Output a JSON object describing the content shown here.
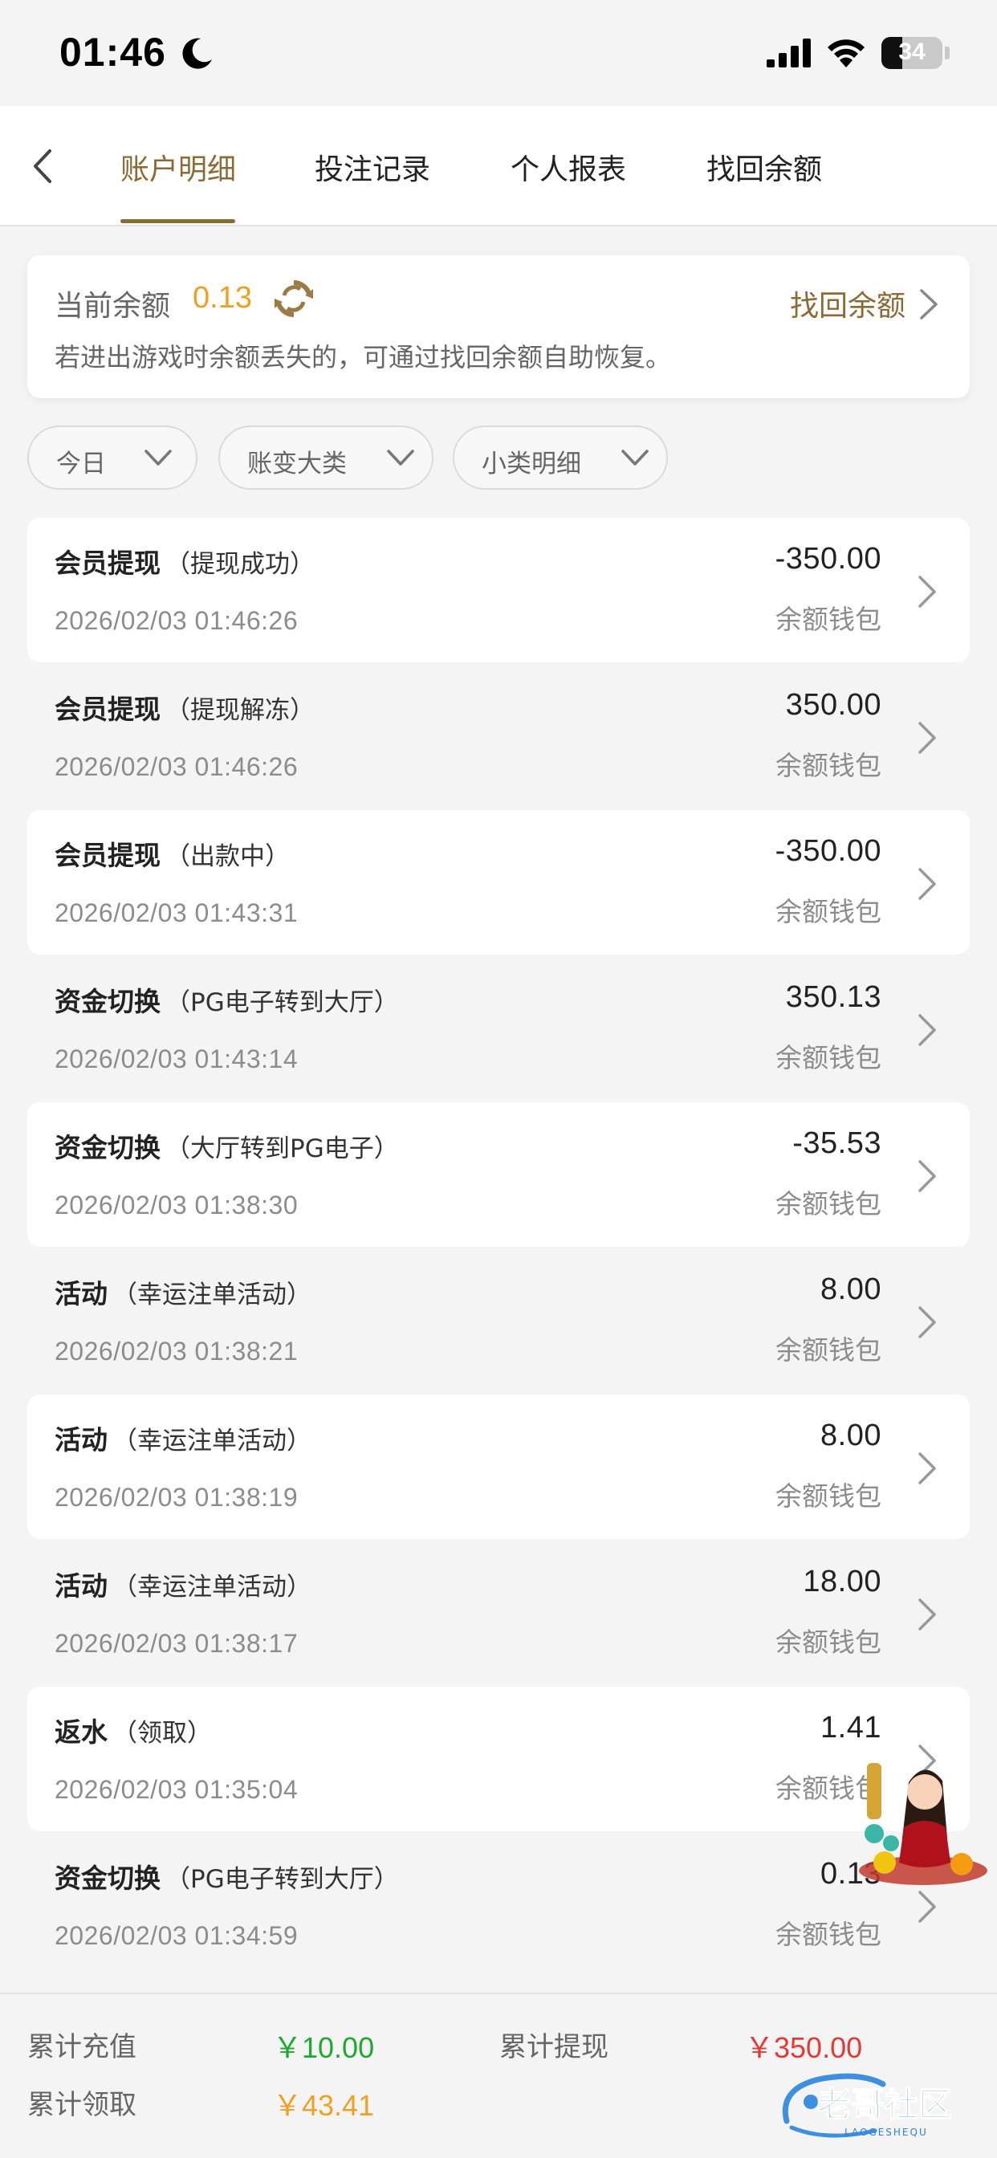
{
  "status_bar": {
    "time": "01:46",
    "battery": "34",
    "battery_level": 0.34
  },
  "nav": {
    "tabs": [
      {
        "label": "账户明细",
        "active": true
      },
      {
        "label": "投注记录",
        "active": false
      },
      {
        "label": "个人报表",
        "active": false
      },
      {
        "label": "找回余额",
        "active": false
      }
    ],
    "accent_color": "#8a6a35"
  },
  "balance": {
    "label": "当前余额",
    "value": "0.13",
    "recover_label": "找回余额",
    "tip": "若进出游戏时余额丢失的，可通过找回余额自助恢复。"
  },
  "filters": [
    {
      "label": "今日"
    },
    {
      "label": "账变大类"
    },
    {
      "label": "小类明细"
    }
  ],
  "records": [
    {
      "type": "会员提现",
      "detail": "（提现成功）",
      "time": "2026/02/03 01:46:26",
      "amount": "-350.00",
      "wallet": "余额钱包"
    },
    {
      "type": "会员提现",
      "detail": "（提现解冻）",
      "time": "2026/02/03 01:46:26",
      "amount": "350.00",
      "wallet": "余额钱包"
    },
    {
      "type": "会员提现",
      "detail": "（出款中）",
      "time": "2026/02/03 01:43:31",
      "amount": "-350.00",
      "wallet": "余额钱包"
    },
    {
      "type": "资金切换",
      "detail": "（PG电子转到大厅）",
      "time": "2026/02/03 01:43:14",
      "amount": "350.13",
      "wallet": "余额钱包"
    },
    {
      "type": "资金切换",
      "detail": "（大厅转到PG电子）",
      "time": "2026/02/03 01:38:30",
      "amount": "-35.53",
      "wallet": "余额钱包"
    },
    {
      "type": "活动",
      "detail": "（幸运注单活动）",
      "time": "2026/02/03 01:38:21",
      "amount": "8.00",
      "wallet": "余额钱包"
    },
    {
      "type": "活动",
      "detail": "（幸运注单活动）",
      "time": "2026/02/03 01:38:19",
      "amount": "8.00",
      "wallet": "余额钱包"
    },
    {
      "type": "活动",
      "detail": "（幸运注单活动）",
      "time": "2026/02/03 01:38:17",
      "amount": "18.00",
      "wallet": "余额钱包"
    },
    {
      "type": "返水",
      "detail": "（领取）",
      "time": "2026/02/03 01:35:04",
      "amount": "1.41",
      "wallet": "余额钱包"
    },
    {
      "type": "资金切换",
      "detail": "（PG电子转到大厅）",
      "time": "2026/02/03 01:34:59",
      "amount": "0.13",
      "wallet": "余额钱包"
    }
  ],
  "summary": {
    "recharge_label": "累计充值",
    "recharge_value": "￥10.00",
    "withdraw_label": "累计提现",
    "withdraw_value": "￥350.00",
    "claim_label": "累计领取",
    "claim_value": "￥43.41",
    "colors": {
      "recharge": "#1fa92f",
      "withdraw": "#e53935",
      "claim": "#f0a020"
    }
  },
  "watermark": {
    "text": "老哥社区",
    "subtext": "LAOGESHEQU"
  }
}
